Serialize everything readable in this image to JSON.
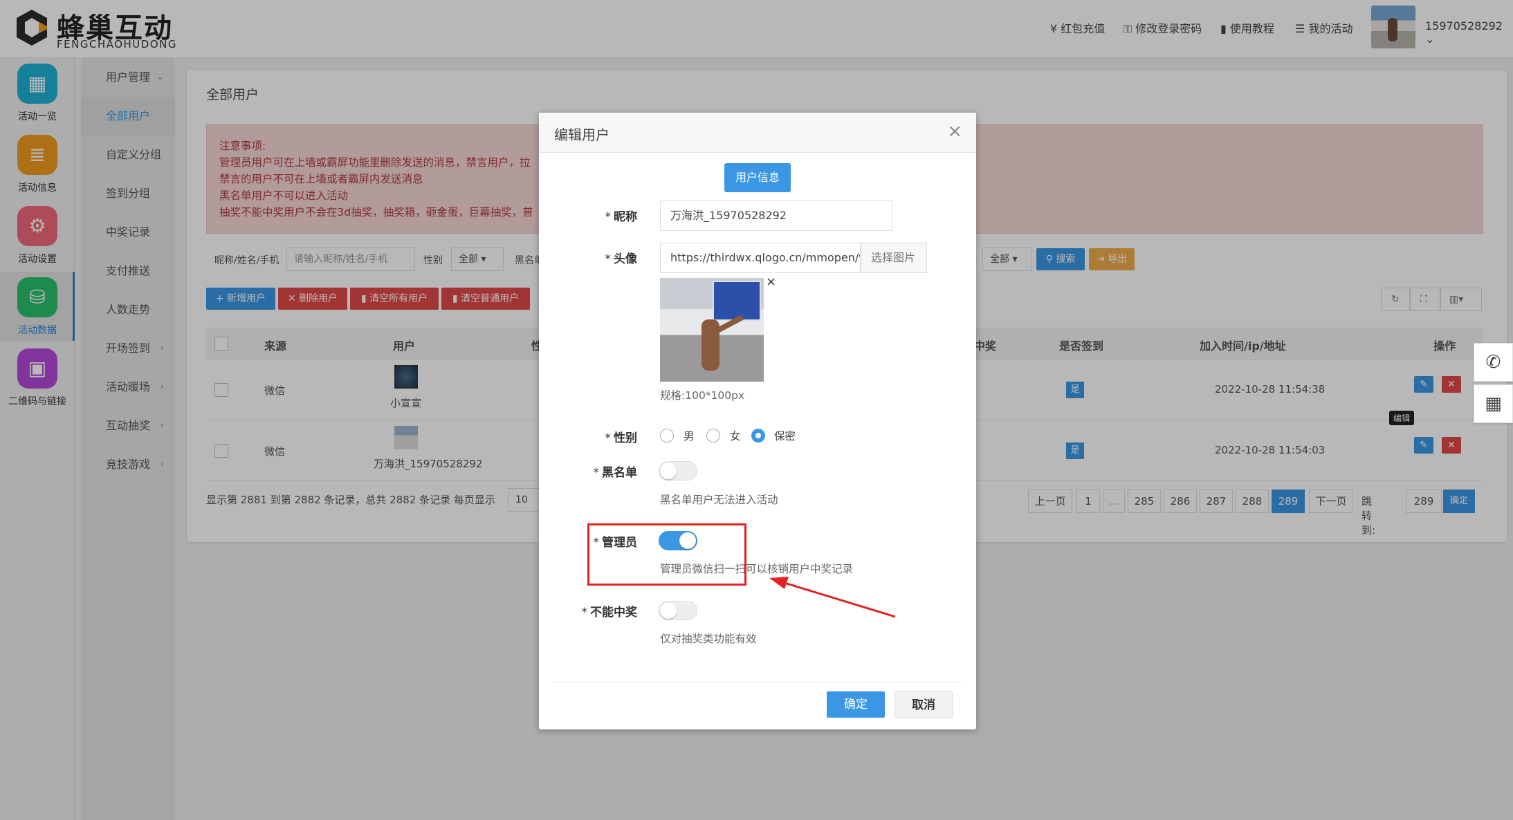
{
  "header": {
    "logo_cn": "蜂巢互动",
    "logo_en": "FENGCHAOHUDONG",
    "nav": [
      {
        "icon": "yen-icon",
        "label": "¥ 红包充值"
      },
      {
        "icon": "key-icon",
        "label": "修改登录密码"
      },
      {
        "icon": "doc-icon",
        "label": "使用教程"
      },
      {
        "icon": "list-icon",
        "label": "我的活动"
      }
    ],
    "username": "15970528292",
    "username_caret": "⌄"
  },
  "sidebar": {
    "items": [
      {
        "label": "活动一览",
        "color": "#1fb1d6",
        "glyph": "▦"
      },
      {
        "label": "活动信息",
        "color": "#f29c1f",
        "glyph": "≣"
      },
      {
        "label": "活动设置",
        "color": "#f06a7a",
        "glyph": "⚙"
      },
      {
        "label": "活动数据",
        "color": "#2bbf6b",
        "glyph": "⛁"
      },
      {
        "label": "二维码与链接",
        "color": "#b34ad8",
        "glyph": "▣"
      }
    ]
  },
  "subnav": {
    "items": [
      {
        "label": "用户管理",
        "caret": "⌄"
      },
      {
        "label": "全部用户",
        "caret": ""
      },
      {
        "label": "自定义分组",
        "caret": ""
      },
      {
        "label": "签到分组",
        "caret": ""
      },
      {
        "label": "中奖记录",
        "caret": ""
      },
      {
        "label": "支付推送",
        "caret": ""
      },
      {
        "label": "人数走势",
        "caret": ""
      },
      {
        "label": "开场签到",
        "caret": "›"
      },
      {
        "label": "活动暖场",
        "caret": "›"
      },
      {
        "label": "互动抽奖",
        "caret": "›"
      },
      {
        "label": "竞技游戏",
        "caret": "›"
      }
    ]
  },
  "panel": {
    "title": "全部用户",
    "notice": [
      "注意事项:",
      "管理员用户可在上墙或霸屏功能里删除发送的消息，禁言用户，拉",
      "禁言的用户不可在上墙或者霸屏内发送消息",
      "黑名单用户不可以进入活动",
      "抽奖不能中奖用户不会在3d抽奖，抽奖箱，砸金蛋，巨幕抽奖，普"
    ],
    "filter": {
      "name_label": "昵称/姓名/手机",
      "name_placeholder": "请输入昵称/姓名/手机",
      "gender_label": "性别",
      "gender_value": "全部",
      "black_label": "黑名单",
      "right_select": "全部",
      "search": "搜索",
      "export": "导出"
    },
    "actions": {
      "add": "+ 新增用户",
      "delete": "✕ 删除用户",
      "clear_all": "清空所有用户",
      "clear_normal": "清空普通用户"
    },
    "table": {
      "headers": [
        "来源",
        "用户",
        "性",
        "中奖",
        "是否签到",
        "加入时间/ip/地址",
        "操作"
      ],
      "rows": [
        {
          "source": "微信",
          "user": "小宣宣",
          "signed": "是",
          "time": "2022-10-28 11:54:38"
        },
        {
          "source": "微信",
          "user": "万海洪_15970528292",
          "signed": "是",
          "time": "2022-10-28 11:54:03"
        }
      ],
      "edit_tooltip": "编辑"
    },
    "footer": {
      "summary": "显示第 2881 到第 2882 条记录，总共 2882 条记录  每页显示",
      "per_page": "10",
      "pages": [
        "上一页",
        "1",
        "...",
        "285",
        "286",
        "287",
        "288",
        "289",
        "下一页"
      ],
      "active_page": "289",
      "jump_label": "跳转到:",
      "jump_value": "289",
      "jump_btn": "确定"
    }
  },
  "modal": {
    "title": "编辑用户",
    "close": "×",
    "tab": "用户信息",
    "nickname_label": "昵称",
    "nickname_value": "万海洪_15970528292",
    "avatar_label": "头像",
    "avatar_url": "https://thirdwx.qlogo.cn/mmopen/vi_",
    "avatar_select": "选择图片",
    "avatar_remove": "×",
    "avatar_spec": "规格:100*100px",
    "gender_label": "性别",
    "gender_options": [
      "男",
      "女",
      "保密"
    ],
    "gender_selected": "保密",
    "blacklist_label": "黑名单",
    "blacklist_on": false,
    "blacklist_hint": "黑名单用户无法进入活动",
    "admin_label": "管理员",
    "admin_on": true,
    "admin_hint": "管理员微信扫一扫可以核销用户中奖记录",
    "nowin_label": "不能中奖",
    "nowin_on": false,
    "nowin_hint": "仅对抽奖类功能有效",
    "ok": "确定",
    "cancel": "取消"
  },
  "colors": {
    "primary": "#3b97e3",
    "danger": "#e24949",
    "warning": "#f0ad4e",
    "annotation": "#e52222"
  }
}
